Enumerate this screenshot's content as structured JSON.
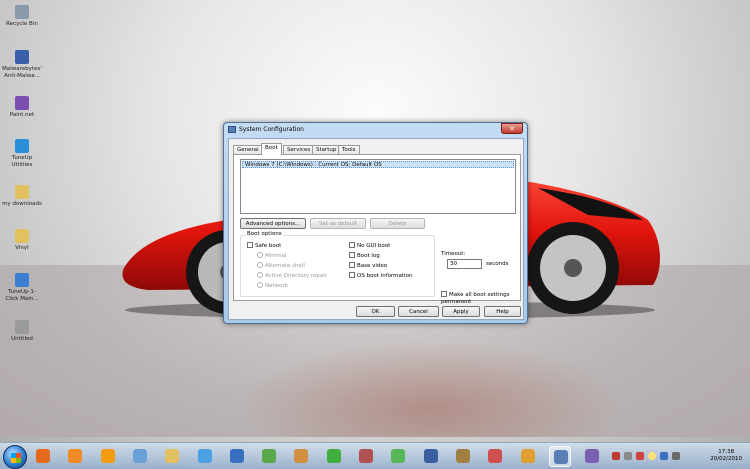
{
  "desktop": {
    "icons": [
      {
        "label": "Recycle Bin",
        "color": "#8a9aa8"
      },
      {
        "label": "Malwarebytes' Anti-Malwa...",
        "color": "#3b5fa8"
      },
      {
        "label": "Paint.net",
        "color": "#7a4fb0"
      },
      {
        "label": "TuneUp Utilities",
        "color": "#2a8fd8"
      },
      {
        "label": "my downloads",
        "color": "#e2c160"
      },
      {
        "label": "Vinyl",
        "color": "#e2c160"
      },
      {
        "label": "TuneUp 1-Click Main...",
        "color": "#3a7fd0"
      },
      {
        "label": "Untitled",
        "color": "#9a9a9a"
      }
    ]
  },
  "dialog": {
    "title": "System Configuration",
    "close_glyph": "✕",
    "tabs": [
      {
        "label": "General"
      },
      {
        "label": "Boot"
      },
      {
        "label": "Services"
      },
      {
        "label": "Startup"
      },
      {
        "label": "Tools"
      }
    ],
    "os_entry": "Windows 7 (C:\\Windows) : Current OS; Default OS",
    "advanced_label": "Advanced options...",
    "set_default_label": "Set as default",
    "delete_label": "Delete",
    "boot_options_label": "Boot options",
    "safe_boot_label": "Safe boot",
    "minimal_label": "Minimal",
    "alternate_shell_label": "Alternate shell",
    "ad_repair_label": "Active Directory repair",
    "network_label": "Network",
    "no_gui_label": "No GUI boot",
    "boot_log_label": "Boot log",
    "base_video_label": "Base video",
    "os_boot_info_label": "OS boot information",
    "timeout_label": "Timeout:",
    "timeout_value": "30",
    "seconds_label": "seconds",
    "permanent_label": "Make all boot settings permanent",
    "ok_label": "OK",
    "cancel_label": "Cancel",
    "apply_label": "Apply",
    "help_label": "Help"
  },
  "taskbar": {
    "pinned": [
      {
        "icon": "firefox-icon",
        "color": "#e66a1c"
      },
      {
        "icon": "media-player-icon",
        "color": "#f08a24"
      },
      {
        "icon": "vlc-icon",
        "color": "#f39c12"
      },
      {
        "icon": "network-icon",
        "color": "#6a9fd8"
      },
      {
        "icon": "folder-icon",
        "color": "#e2c160"
      },
      {
        "icon": "image-icon",
        "color": "#4aa0e0"
      },
      {
        "icon": "game-icon",
        "color": "#3a6fc0"
      },
      {
        "icon": "messenger-icon",
        "color": "#5aa84a"
      },
      {
        "icon": "photo-icon",
        "color": "#d09040"
      },
      {
        "icon": "check-icon",
        "color": "#3fae3f"
      },
      {
        "icon": "app-icon",
        "color": "#b05050"
      },
      {
        "icon": "sims-icon",
        "color": "#58b858"
      },
      {
        "icon": "shield-icon",
        "color": "#3a5fa0"
      },
      {
        "icon": "game2-icon",
        "color": "#a08040"
      },
      {
        "icon": "mail-icon",
        "color": "#d05050"
      },
      {
        "icon": "chat-icon",
        "color": "#e0a030"
      },
      {
        "icon": "system-config-icon",
        "color": "#5a7fb4"
      },
      {
        "icon": "paint-icon",
        "color": "#7a5fb0"
      }
    ],
    "time": "17:38",
    "date": "20/02/2010"
  }
}
